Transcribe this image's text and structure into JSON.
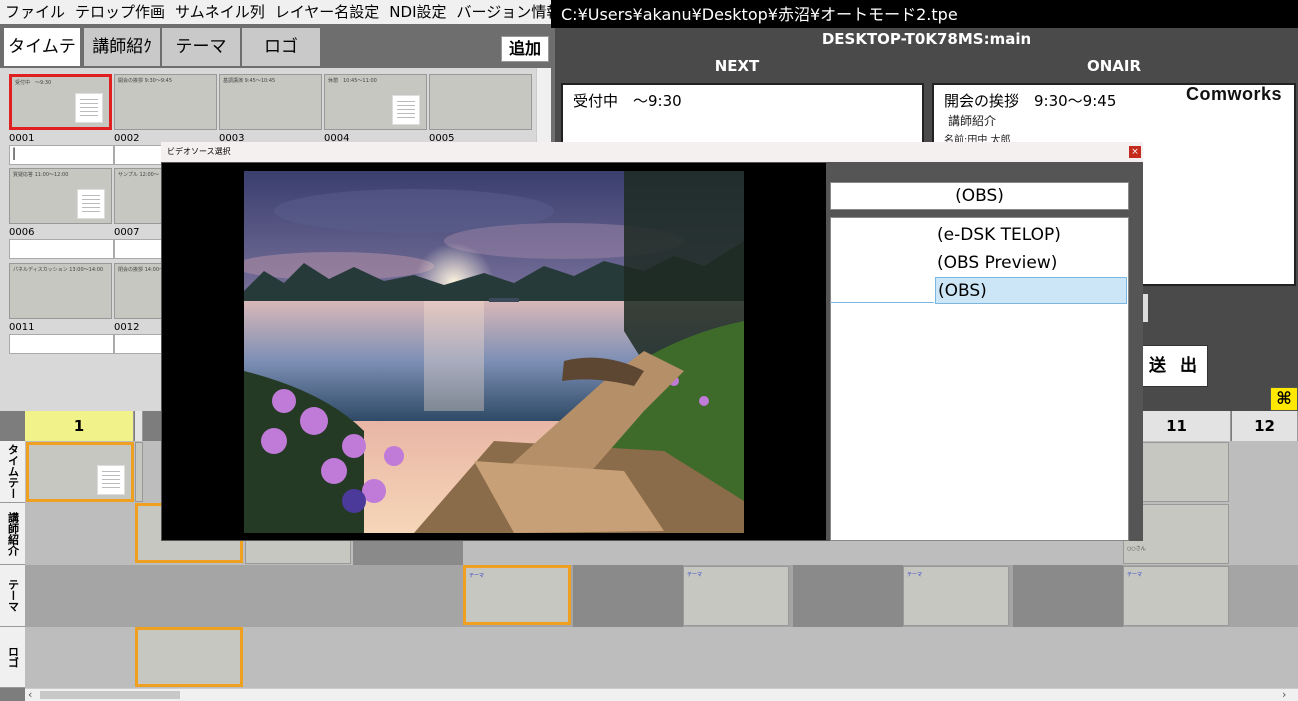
{
  "menu": [
    "ファイル",
    "テロップ作画",
    "サムネイル列",
    "レイヤー名設定",
    "NDI設定",
    "バージョン情報"
  ],
  "window_title": "C:¥Users¥akanu¥Desktop¥赤沼¥オートモード2.tpe",
  "tabs": [
    "タイムテー",
    "講師紹ｸ",
    "テーマ",
    "ロゴ"
  ],
  "add_label": "追加",
  "thumbnails": [
    {
      "num": "0001",
      "caption": "受付中　〜9:30",
      "selected": true,
      "field": "|"
    },
    {
      "num": "0002",
      "caption": "開会の挨拶 9:30〜9:45",
      "selected": false,
      "field": ""
    },
    {
      "num": "0003",
      "caption": "基調講演 9:45〜10:45",
      "selected": false,
      "field": ""
    },
    {
      "num": "0004",
      "caption": "休憩　10:45〜11:00",
      "selected": false,
      "field": ""
    },
    {
      "num": "0005",
      "caption": "",
      "selected": false,
      "field": ""
    },
    {
      "num": "0006",
      "caption": "質疑応答 11:00〜12:00",
      "selected": false,
      "field": ""
    },
    {
      "num": "0007",
      "caption": "サンプル 12:00〜",
      "selected": false,
      "field": ""
    },
    {
      "num": "0011",
      "caption": "パネルディスカッション 13:00〜14:00",
      "selected": false,
      "field": ""
    },
    {
      "num": "0012",
      "caption": "閉会の挨拶 14:00〜",
      "selected": false,
      "field": ""
    }
  ],
  "monitor": {
    "host": "DESKTOP-T0K78MS:main",
    "next_label": "NEXT",
    "onair_label": "ONAIR",
    "next_title": "受付中　〜9:30",
    "onair_title": "開会の挨拶　9:30〜9:45",
    "onair_sub": "講師紹介",
    "onair_name": "名前:田中 太郎",
    "logo": "Comworks",
    "send_label": "送 出"
  },
  "timeline": {
    "columns": [
      "1",
      "11",
      "12"
    ],
    "rows": [
      "タイムテー",
      "講師紹介",
      "テーマ",
      "ロゴ"
    ],
    "theme_label": "テーマ",
    "presenter_tag": "○○さん"
  },
  "dialog": {
    "title": "ビデオソース選択",
    "close": "×",
    "current_source": "(OBS)",
    "sources": [
      "(e-DSK TELOP)",
      "(OBS Preview)",
      "(OBS)"
    ],
    "selected_index": 2
  },
  "colors": {
    "accent_select": "#e02020",
    "clip_select": "#f0a020",
    "list_select": "#cce6f7",
    "col_highlight": "#f2f28a"
  }
}
